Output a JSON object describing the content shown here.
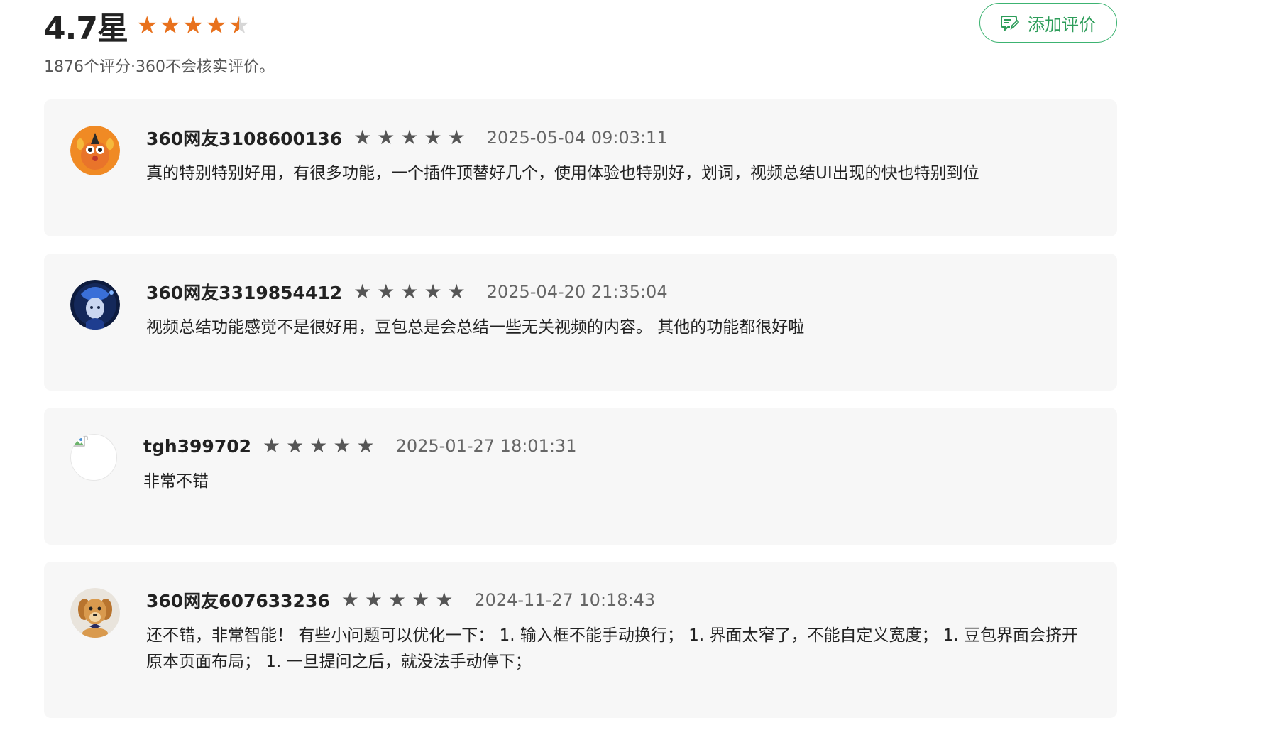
{
  "summary": {
    "rating_value": "4.7星",
    "stars_full": 4,
    "stars_half": 1,
    "stars_total": 5,
    "sub_text": "1876个评分·360不会核实评价。",
    "add_review_label": "添加评价",
    "accent_color": "#e8711d",
    "button_color": "#2e9d5a"
  },
  "reviews": [
    {
      "name": "360网友3108600136",
      "stars": 5,
      "date": "2025-05-04 09:03:11",
      "text": "真的特别特别好用，有很多功能，一个插件顶替好几个，使用体验也特别好，划词，视频总结UI出现的快也特别到位",
      "avatar": "orange-monster-avatar"
    },
    {
      "name": "360网友3319854412",
      "stars": 5,
      "date": "2025-04-20 21:35:04",
      "text": "视频总结功能感觉不是很好用，豆包总是会总结一些无关视频的内容。 其他的功能都很好啦",
      "avatar": "dark-character-avatar"
    },
    {
      "name": "tgh399702",
      "stars": 5,
      "date": "2025-01-27 18:01:31",
      "text": "非常不错",
      "avatar": "broken-image-avatar"
    },
    {
      "name": "360网友607633236",
      "stars": 5,
      "date": "2024-11-27 10:18:43",
      "text": "还不错，非常智能！ 有些小问题可以优化一下： 1. 输入框不能手动换行； 1. 界面太窄了，不能自定义宽度； 1. 豆包界面会挤开原本页面布局； 1. 一旦提问之后，就没法手动停下；",
      "avatar": "puppy-avatar"
    }
  ]
}
